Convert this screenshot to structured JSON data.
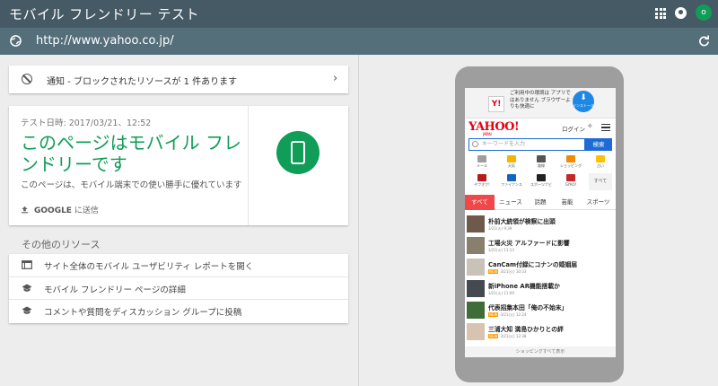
{
  "header": {
    "title": "モバイル フレンドリー テスト",
    "avatar_letter": "o",
    "icons": [
      "apps-grid-icon",
      "notifications-icon",
      "avatar"
    ]
  },
  "urlbar": {
    "url": "http://www.yahoo.co.jp/"
  },
  "notice": {
    "text": "通知 - ブロックされたリソースが 1 件あります"
  },
  "result": {
    "date": "テスト日時: 2017/03/21、12:52",
    "headline": "このページはモバイル フレンドリーです",
    "description": "このページは、モバイル端末での使い勝手に優れています",
    "share_label": "GOOGLE",
    "share_suffix": " に送信",
    "accent_color": "#0f9d58"
  },
  "resources": {
    "title": "その他のリソース",
    "items": [
      {
        "label": "サイト全体のモバイル ユーザビリティ レポートを開く",
        "icon": "browser-window-icon"
      },
      {
        "label": "モバイル フレンドリー ページの詳細",
        "icon": "school-cap-icon"
      },
      {
        "label": "コメントや質問をディスカッション グループに投稿",
        "icon": "school-cap-icon"
      }
    ]
  },
  "preview": {
    "ad": {
      "logo": "Y!",
      "text": "ご利用中の環境は アプリではありません ブラウザーよりも快適に",
      "install": "インストール"
    },
    "logo": "YAHOO!",
    "logo_sub": "JAPAN",
    "login": "ログイン",
    "search_placeholder": "キーワードを入力",
    "search_button": "検索",
    "grid": [
      {
        "label": "メール",
        "color": "#9e9e9e"
      },
      {
        "label": "天気",
        "color": "#f5b400"
      },
      {
        "label": "路線",
        "color": "#555555"
      },
      {
        "label": "ショッピング",
        "color": "#f08c00"
      },
      {
        "label": "占い",
        "color": "#ffc107"
      },
      {
        "label": "ヤフオク!",
        "color": "#b71c1c"
      },
      {
        "label": "ファイナンス",
        "color": "#1565c0"
      },
      {
        "label": "スポーツナビ",
        "color": "#212121"
      },
      {
        "label": "GYAO!",
        "color": "#c62828"
      },
      {
        "label": "すべて",
        "color": "#f2f2f2"
      }
    ],
    "tabs": [
      "すべて",
      "ニュース",
      "話題",
      "芸能",
      "スポーツ"
    ],
    "news": [
      {
        "title": "朴前大統領が検察に出頭",
        "meta": "3/21(火) 9:39",
        "is_new": false
      },
      {
        "title": "工場火災 アルファードに影響",
        "meta": "3/21(火) 11:13",
        "is_new": false
      },
      {
        "title": "CanCam付録にコナンの婚姻届",
        "meta": "3/21(火) 10:33",
        "is_new": true
      },
      {
        "title": "新iPhone AR機能搭載か",
        "meta": "3/21(火) 11:09",
        "is_new": false
      },
      {
        "title": "代表招集本田「俺の不始末」",
        "meta": "3/21(火) 12:24",
        "is_new": true
      },
      {
        "title": "三浦大知 満島ひかりとの絆",
        "meta": "3/21(火) 12:38",
        "is_new": true
      }
    ],
    "new_badge": "NEW",
    "footer": "ショッピングすべて表示"
  }
}
